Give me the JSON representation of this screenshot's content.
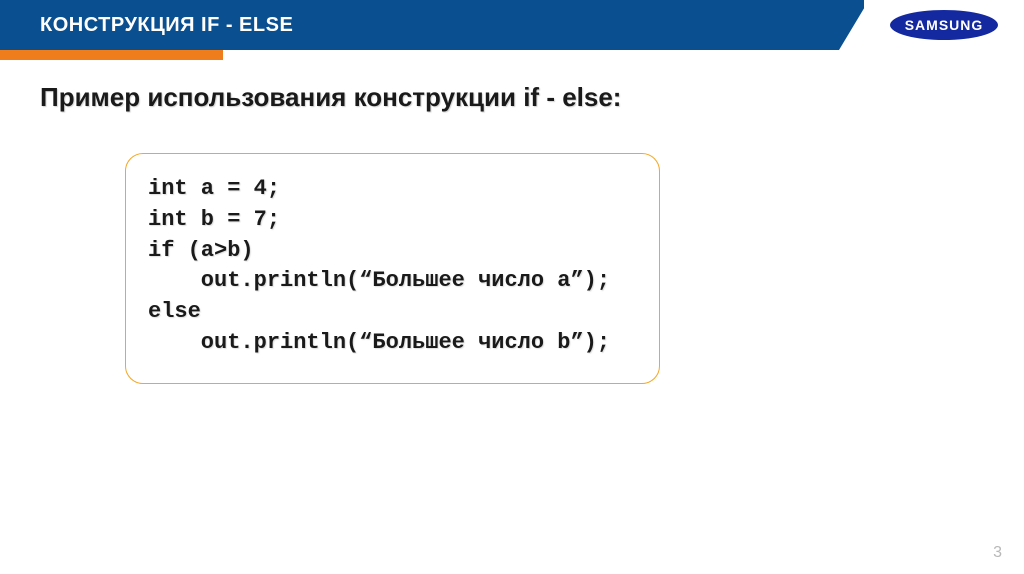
{
  "header": {
    "title": "КОНСТРУКЦИЯ IF - ELSE"
  },
  "branding": {
    "logo_text": "SAMSUNG"
  },
  "content": {
    "subtitle": "Пример использования конструкции if - else:",
    "code_lines": [
      "int a = 4;",
      "int b = 7;",
      "if (a>b)",
      "    out.println(“Большее число a”);",
      "else",
      "    out.println(“Большее число b”);"
    ]
  },
  "page_number": "3"
}
